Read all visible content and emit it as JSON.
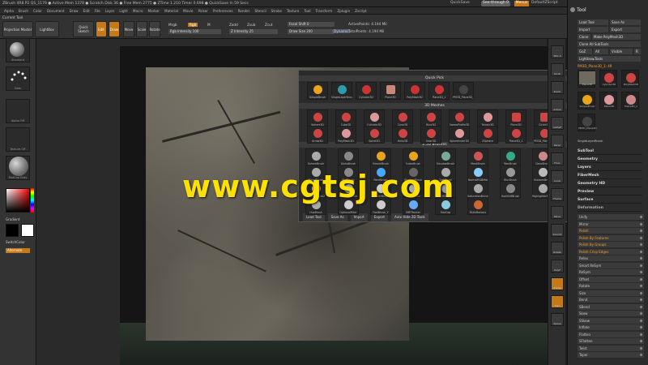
{
  "titlebar": {
    "left": "ZBrush 4R8 P2    QS_1179    ● Active Mem 1378 ● Scratch Disk 36 ● Free Mem 2775 ● ZTime 1.210 Timer 0.698 ● QuickSave In 59 Secs",
    "quicksave": "QuickSave",
    "seethrough": "See-through 0",
    "menus": "Menus",
    "ui": "DefaultZScript"
  },
  "menubar": [
    "Alpha",
    "Brush",
    "Color",
    "Document",
    "Draw",
    "Edit",
    "File",
    "Layer",
    "Light",
    "Macro",
    "Marker",
    "Material",
    "Movie",
    "Picker",
    "Preferences",
    "Render",
    "Stencil",
    "Stroke",
    "Texture",
    "Tool",
    "Transform",
    "Zplugin",
    "Zscript"
  ],
  "current_tool": "Current Tool",
  "toolbar": {
    "projection_master": "Projection Master",
    "lightbox": "LightBox",
    "quick_sketch": "Quick Sketch",
    "edit": "Edit",
    "draw": "Draw",
    "move": "Move",
    "scale": "Scale",
    "rotate": "Rotate",
    "mrgb": "Mrgb",
    "rgb": "Rgb",
    "m": "M",
    "rgb_intensity": "Rgb Intensity 100",
    "zadd": "Zadd",
    "zsub": "Zsub",
    "zcut": "Zcut",
    "z_intensity": "Z Intensity 25",
    "focal_shift": "Focal Shift 0",
    "draw_size": "Draw Size 200",
    "dynamic": "Dynamic",
    "active_points": "ActivePoints: 4.194 Mil",
    "total_points": "TotalPoints: 4.194 Mil"
  },
  "left": {
    "standard": "Standard",
    "dots": "Dots",
    "alpha_off": "Alpha Off",
    "texture_off": "Texture Off",
    "material": "MatCap Gray",
    "gradient": "Gradient",
    "switch_color": "SwitchColor",
    "alternate": "Alternate",
    "colors": {
      "main": "#000000",
      "secondary": "#ffffff",
      "accent": "#c57a1a"
    }
  },
  "watermark": "www.cgtsj.com",
  "popup": {
    "quick_pick": "Quick Pick",
    "quick_items": [
      "SimpleBrush",
      "SingleLayerBrush",
      "Cylinder3D",
      "Plane3D",
      "PolyMesh3D",
      "Plane3D_1",
      "PM3D_Plane3D_1"
    ],
    "meshes_title": "3D Meshes",
    "meshes": [
      "Sphere3D",
      "Cube3D",
      "Cylinder3D",
      "Cone3D",
      "Ring3D",
      "SweepProfile3D",
      "Terrain3D",
      "Plane3D",
      "Circle3D",
      "Arrow3D",
      "PolyMesh3D",
      "Spiral3D",
      "Helix3D",
      "Gear3D",
      "Sphereinder3D",
      "ZSphere",
      "Plane3D_1",
      "PM3D_Plane3D_1"
    ],
    "brushes_title": "2.5D Brushes",
    "brushes": [
      "SphereBrush",
      "AlphaBrush",
      "SimpleBrush",
      "SnakeBrush",
      "SmudgeBrush",
      "MaskBrush",
      "FiberBrush",
      "DecoBrush",
      "BlendBrush",
      "FlatBrush",
      "PaintBrush",
      "ShadowBrush",
      "GrabBrush",
      "NormalRGBMat",
      "BlurBrush",
      "SharpenBrush",
      "SimpleBrush2",
      "OptionalBrush",
      "ClonerBrush",
      "KnifeBrush",
      "RGBShade",
      "SaturationBrush",
      "HueShiftBrush",
      "HighlighterBrush",
      "HueBrush",
      "OptionalFilter",
      "FastBrush_Y",
      "MRTPointer",
      "MatCap",
      "MultiMarkers"
    ],
    "footer": {
      "load": "Load Tool",
      "save": "Save As",
      "import": "Import",
      "export": "Export",
      "auto_hide": "Auto Hide 2D Tools"
    }
  },
  "rightshelf": [
    "SPix 3",
    "Scroll",
    "Zoom",
    "Actual",
    "AAHalf",
    "Persp",
    "Floor",
    "Local",
    "Frame",
    "Move",
    "ZoomD",
    "Rotate",
    "PolyF",
    "Transp",
    "Solo",
    "Xpose"
  ],
  "tray": {
    "title": "Tool",
    "load_tool": "Load Tool",
    "save_as": "Save As",
    "import": "Import",
    "export": "Export",
    "clone": "Clone",
    "make_polymesh": "Make PolyMesh3D",
    "clone_all": "Clone All SubTools",
    "goz": "GoZ",
    "all": "All",
    "visible": "Visible",
    "r": "R",
    "lightbox_tools": "Lightbox▸Tools",
    "tool_name": "PM3D_Plane3D_1: 49",
    "tools": [
      "Plane3D",
      "Cylinder3D",
      "PolyMesh3D",
      "SimpleBrush",
      "Plane3D",
      "Plane3D_1",
      "PM3D_Plane3D"
    ],
    "single_layer": "SingleLayerBrush",
    "sections": [
      "SubTool",
      "Geometry",
      "Layers",
      "FiberMesh",
      "Geometry HD",
      "Preview",
      "Surface",
      "Deformation"
    ],
    "deform": [
      {
        "label": "Unify",
        "hl": false
      },
      {
        "label": "Mirror",
        "hl": false
      },
      {
        "label": "Polish",
        "hl": true
      },
      {
        "label": "Polish By Features",
        "hl": true
      },
      {
        "label": "Polish By Groups",
        "hl": true
      },
      {
        "label": "Polish Crisp Edges",
        "hl": true
      },
      {
        "label": "Relax",
        "hl": false
      },
      {
        "label": "Smart ReSym",
        "hl": false
      },
      {
        "label": "ReSym",
        "hl": false
      },
      {
        "label": "Offset",
        "hl": false
      },
      {
        "label": "Rotate",
        "hl": false
      },
      {
        "label": "Size",
        "hl": false
      },
      {
        "label": "Bend",
        "hl": false
      },
      {
        "label": "SBend",
        "hl": false
      },
      {
        "label": "Skew",
        "hl": false
      },
      {
        "label": "SSkew",
        "hl": false
      },
      {
        "label": "Inflate",
        "hl": false
      },
      {
        "label": "Flatten",
        "hl": false
      },
      {
        "label": "SFlatten",
        "hl": false
      },
      {
        "label": "Twist",
        "hl": false
      },
      {
        "label": "Taper",
        "hl": false
      }
    ]
  }
}
